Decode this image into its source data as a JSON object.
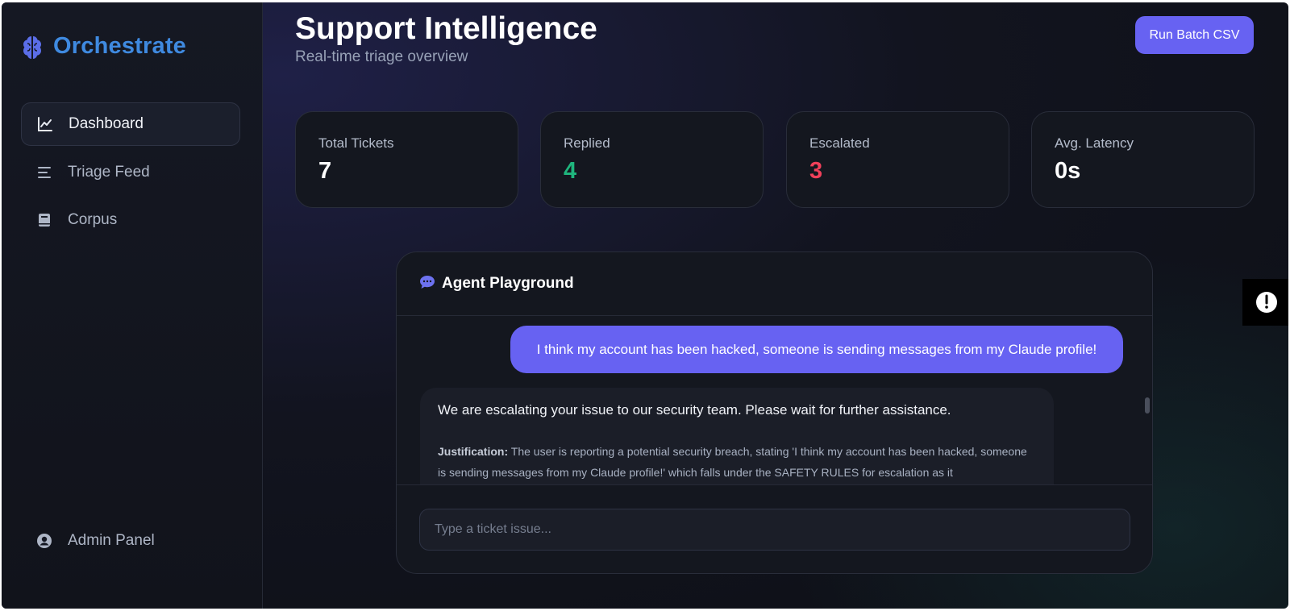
{
  "app": {
    "name": "Orchestrate",
    "brand_color": "#3f8ae0",
    "brand_icon": "brain-icon"
  },
  "sidebar": {
    "items": [
      {
        "label": "Dashboard",
        "icon": "line-chart-icon",
        "active": true
      },
      {
        "label": "Triage Feed",
        "icon": "list-icon",
        "active": false
      },
      {
        "label": "Corpus",
        "icon": "book-icon",
        "active": false
      }
    ],
    "footer_item": {
      "label": "Admin Panel",
      "icon": "user-circle-icon"
    }
  },
  "header": {
    "title": "Support Intelligence",
    "subtitle": "Real-time triage overview",
    "action_label": "Run Batch CSV"
  },
  "stats": [
    {
      "label": "Total Tickets",
      "value": "7",
      "color": "#ffffff"
    },
    {
      "label": "Replied",
      "value": "4",
      "color": "#1fb57d"
    },
    {
      "label": "Escalated",
      "value": "3",
      "color": "#f0405a"
    },
    {
      "label": "Avg. Latency",
      "value": "0s",
      "color": "#ffffff"
    }
  ],
  "playground": {
    "title": "Agent Playground",
    "icon": "chat-bubble-icon",
    "messages": {
      "user": "I think my account has been hacked, someone is sending messages from my Claude profile!",
      "agent_reply": "We are escalating your issue to our security team. Please wait for further assistance.",
      "justification_label": "Justification:",
      "justification_text": "The user is reporting a potential security breach, stating 'I think my account has been hacked, someone is sending messages from my Claude profile!' which falls under the SAFETY RULES for escalation as it"
    },
    "input_placeholder": "Type a ticket issue..."
  },
  "accent_color": "#6762f2"
}
